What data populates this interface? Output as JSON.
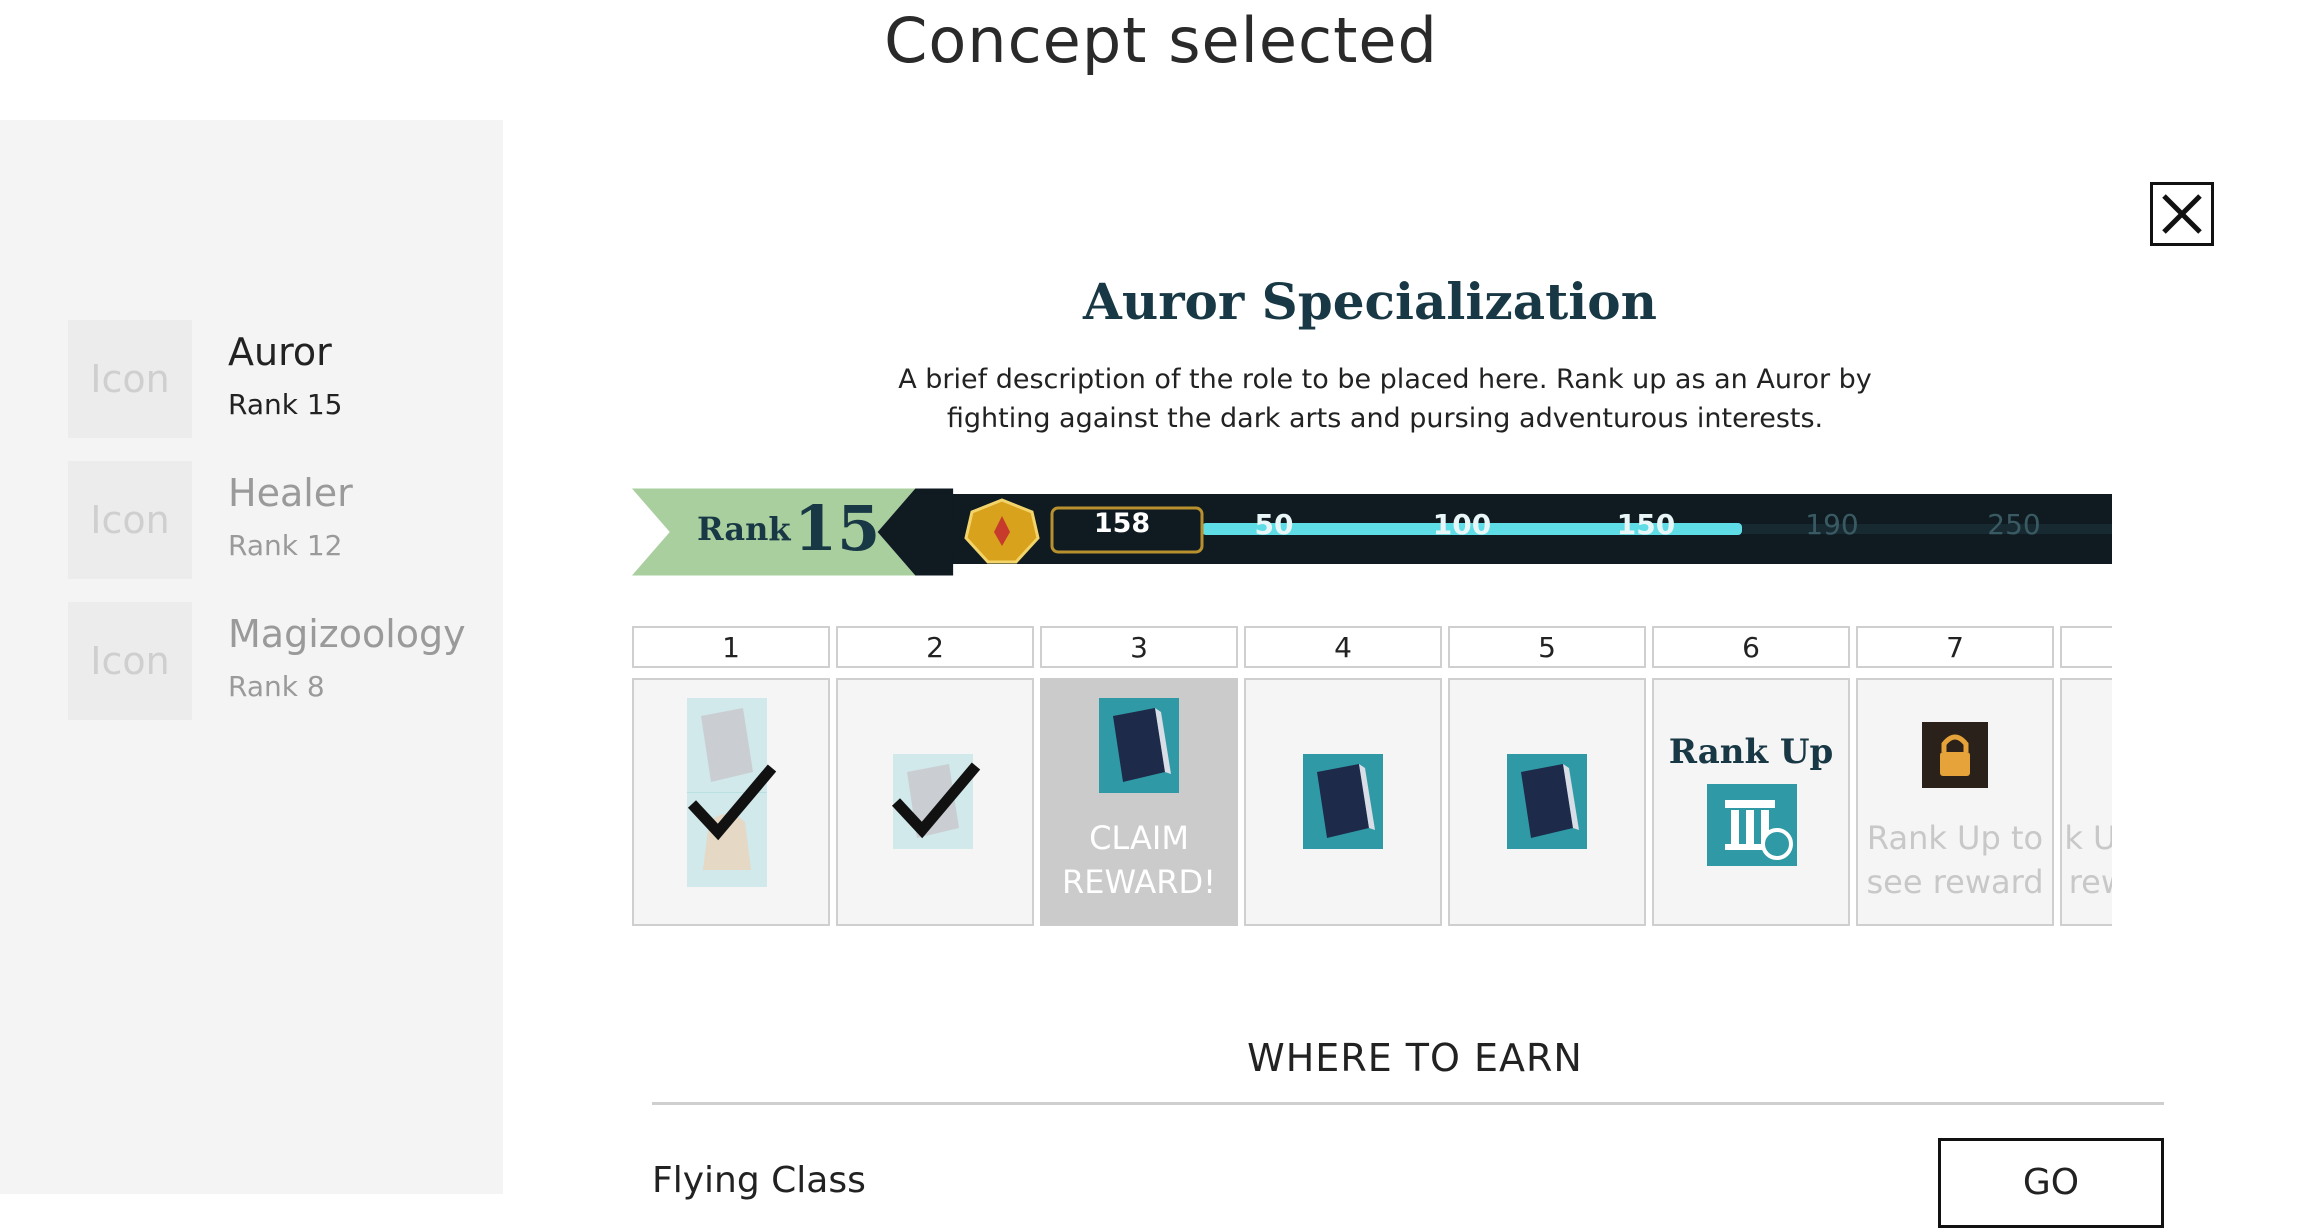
{
  "page_title": "Concept selected",
  "specializations": [
    {
      "icon_label": "Icon",
      "name": "Auror",
      "rank": "Rank 15"
    },
    {
      "icon_label": "Icon",
      "name": "Healer",
      "rank": "Rank 12"
    },
    {
      "icon_label": "Icon",
      "name": "Magizoology",
      "rank": "Rank 8"
    }
  ],
  "panel": {
    "title": "Auror Specialization",
    "description": "A brief description of the role to be placed here. Rank up as an Auror by fighting against the dark arts and pursing adventurous interests."
  },
  "rank_bar": {
    "label": "Rank",
    "number": "15",
    "xp": "158",
    "milestones": [
      "50",
      "100",
      "150",
      "190",
      "250"
    ]
  },
  "rewards": {
    "columns": [
      "1",
      "2",
      "3",
      "4",
      "5",
      "6",
      "7",
      ""
    ],
    "claim_label": "CLAIM REWARD!",
    "rank_up_label": "Rank Up",
    "locked_label": "Rank Up to see reward"
  },
  "earn": {
    "title": "WHERE TO EARN",
    "items": [
      {
        "name": "Flying Class",
        "button": "GO"
      }
    ]
  },
  "colors": {
    "accent": "#173844",
    "ribbon": "#a9cf9f",
    "xp_bar": "#5fdde6",
    "strip": "#0f1b21"
  }
}
